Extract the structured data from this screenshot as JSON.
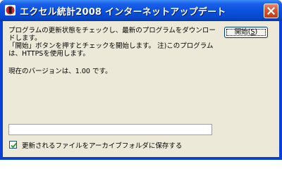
{
  "window": {
    "title": "エクセル統計2008 インターネットアップデート",
    "app_icon": "excel-statistics-app-icon",
    "close_icon": "close-icon"
  },
  "main": {
    "description_line1": "プログラムの更新状態をチェックし、最新のプログラムをダウンロードします。",
    "description_line2": "「開始」ボタンを押すとチェックを開始します。 注)このプログラムは、HTTPSを使用します。",
    "version_text": "現在のバージョンは、1.00 です。"
  },
  "start_button": {
    "label_prefix": "開始(",
    "mnemonic": "S",
    "label_suffix": ")"
  },
  "progress": {
    "value": 0
  },
  "save_option": {
    "checked": true,
    "label": "更新されるファイルをアーカイブフォルダに保存する"
  },
  "colors": {
    "titlebar": "#0a50dd",
    "dialog_background": "#ece9d8",
    "close_button": "#d9542f"
  }
}
